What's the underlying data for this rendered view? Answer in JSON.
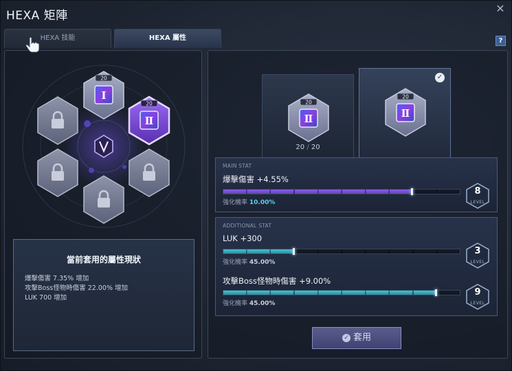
{
  "window": {
    "title": "HEXA 矩陣",
    "close_label": "✕",
    "help_label": "?"
  },
  "tabs": [
    {
      "label": "HEXA 技能",
      "active": false
    },
    {
      "label": "HEXA 屬性",
      "active": true
    }
  ],
  "hex_nodes": [
    {
      "position": "top",
      "state": "unlocked",
      "level": "20",
      "glyph": "Ⅰ"
    },
    {
      "position": "upper-right",
      "state": "selected",
      "level": "20",
      "glyph": "Ⅱ"
    },
    {
      "position": "upper-left",
      "state": "locked"
    },
    {
      "position": "lower-left",
      "state": "locked"
    },
    {
      "position": "lower-right",
      "state": "locked"
    },
    {
      "position": "bottom",
      "state": "locked"
    }
  ],
  "hex_center_icon": "hexa-v-emblem-icon",
  "status_box": {
    "title": "當前套用的屬性現狀",
    "lines": [
      "爆擊傷害 7.35% 增加",
      "攻擊Boss怪物時傷害 22.00% 增加",
      "LUK 700 增加"
    ]
  },
  "cards": [
    {
      "level": "20",
      "glyph": "Ⅱ",
      "count_current": "20",
      "count_sep": "/",
      "count_max": "20"
    },
    {
      "level": "20",
      "glyph": "Ⅱ",
      "checked": true
    }
  ],
  "main_stat": {
    "section_label": "MAIN STAT",
    "name": "爆擊傷害 +4.55%",
    "rate_label": "強化機率",
    "rate_value": "10.00%",
    "level": "8",
    "level_label": "LEVEL",
    "progress": 0.8,
    "bar_color": "#8b5cf0"
  },
  "additional_stat": {
    "section_label": "ADDITIONAL STAT",
    "stats": [
      {
        "name": "LUK +300",
        "rate_label": "強化機率",
        "rate_value": "45.00%",
        "level": "3",
        "level_label": "LEVEL",
        "progress": 0.3,
        "bar_color": "#3fc6d8"
      },
      {
        "name": "攻擊Boss怪物時傷害 +9.00%",
        "rate_label": "強化機率",
        "rate_value": "45.00%",
        "level": "9",
        "level_label": "LEVEL",
        "progress": 0.9,
        "bar_color": "#3fc6d8"
      }
    ]
  },
  "apply_button": {
    "label": "套用",
    "icon": "check-circle-icon"
  },
  "colors": {
    "accent_purple": "#8b5cf0",
    "accent_cyan": "#3fc6d8",
    "rate_highlight": "#5ad0f0"
  }
}
